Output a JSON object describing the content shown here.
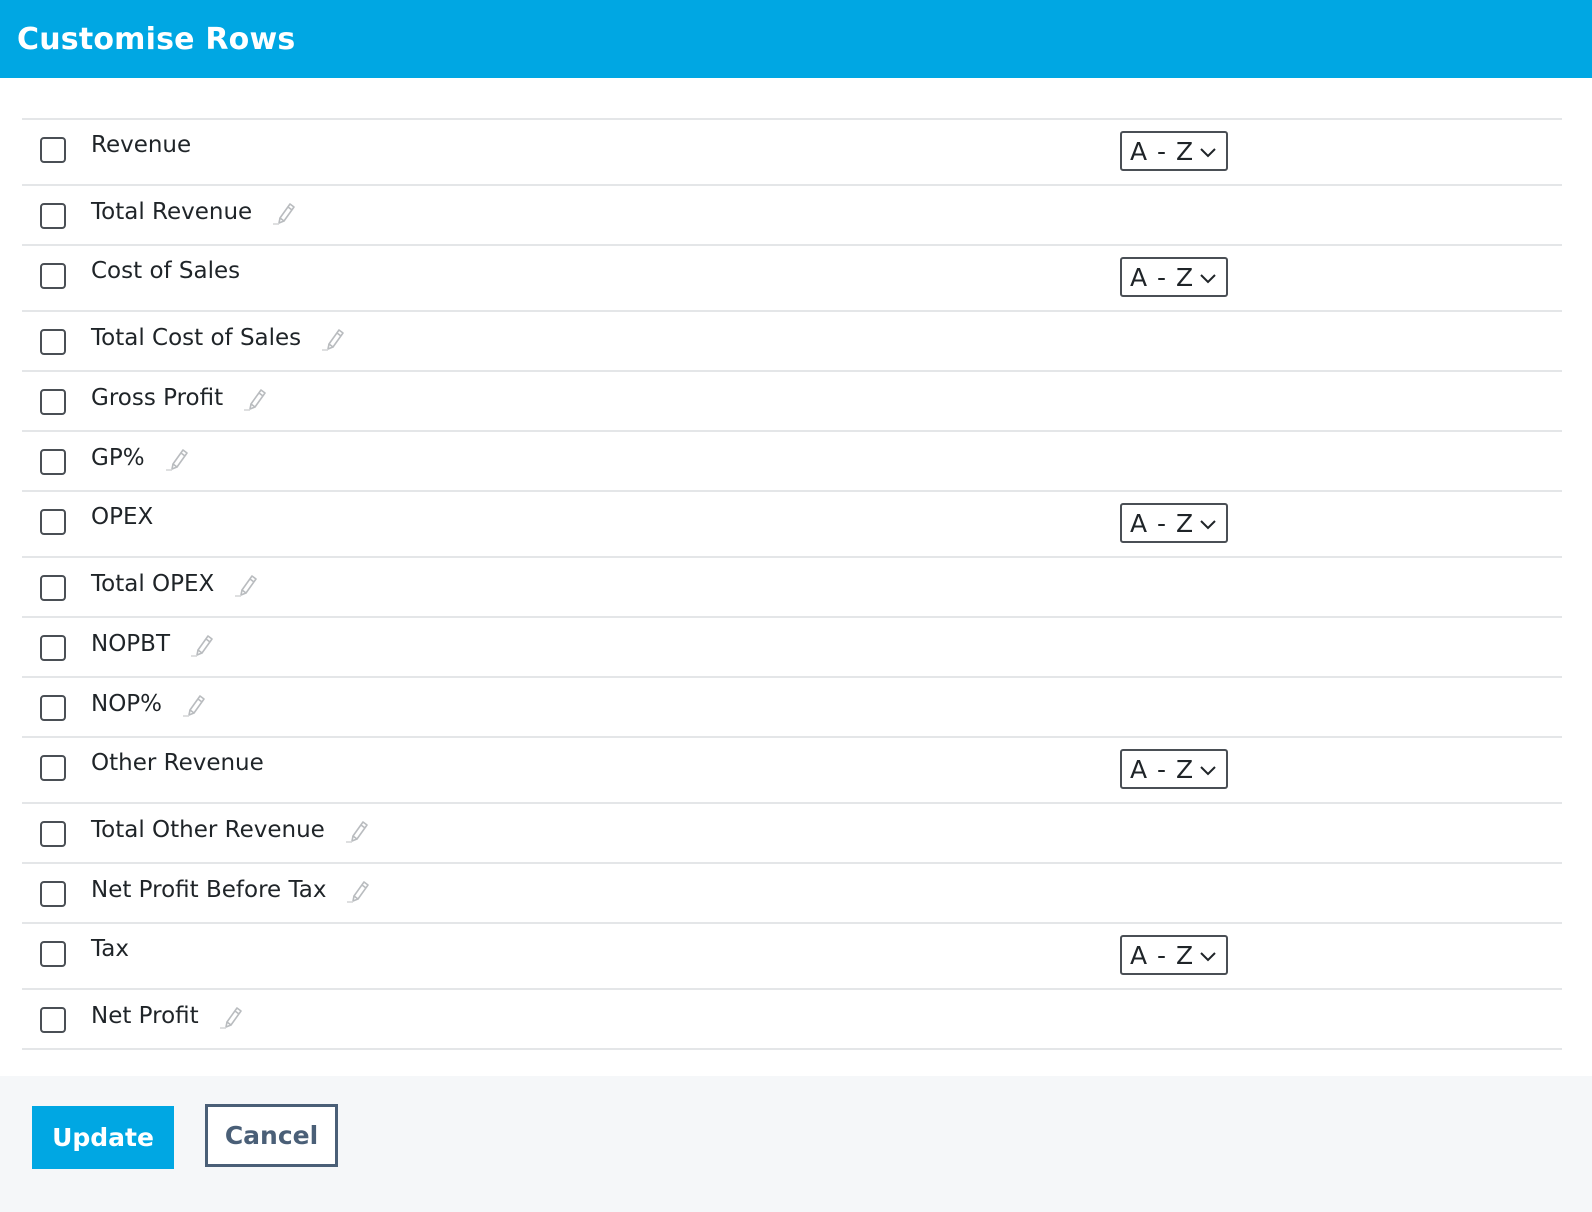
{
  "header": {
    "title": "Customise Rows"
  },
  "rows": [
    {
      "label": "Revenue",
      "editable": false,
      "sort": "A - Z"
    },
    {
      "label": "Total Revenue",
      "editable": true
    },
    {
      "label": "Cost of Sales",
      "editable": false,
      "sort": "A - Z"
    },
    {
      "label": "Total Cost of Sales",
      "editable": true
    },
    {
      "label": "Gross Profit",
      "editable": true
    },
    {
      "label": "GP%",
      "editable": true
    },
    {
      "label": "OPEX",
      "editable": false,
      "sort": "A - Z"
    },
    {
      "label": "Total OPEX",
      "editable": true
    },
    {
      "label": "NOPBT",
      "editable": true
    },
    {
      "label": "NOP%",
      "editable": true
    },
    {
      "label": "Other Revenue",
      "editable": false,
      "sort": "A - Z"
    },
    {
      "label": "Total Other Revenue",
      "editable": true
    },
    {
      "label": "Net Profit Before Tax",
      "editable": true
    },
    {
      "label": "Tax",
      "editable": false,
      "sort": "A - Z"
    },
    {
      "label": "Net Profit",
      "editable": true
    }
  ],
  "footer": {
    "update_label": "Update",
    "cancel_label": "Cancel"
  },
  "colors": {
    "accent": "#00a7e3",
    "cancel_border": "#4a5f77",
    "divider": "#e4e6e8",
    "footer_bg": "#f5f7f9"
  },
  "icons": {
    "edit": "pencil-icon",
    "dropdown": "chevron-down-icon"
  }
}
